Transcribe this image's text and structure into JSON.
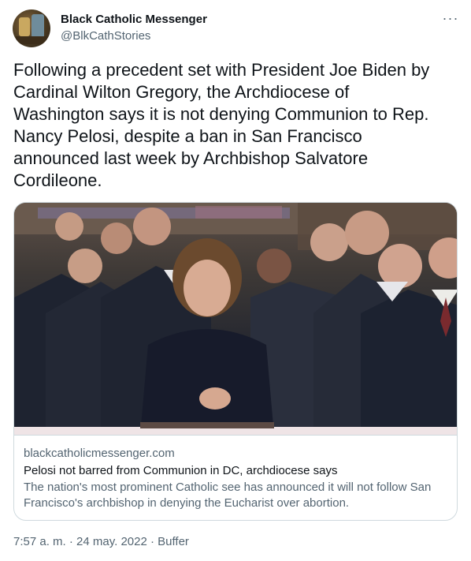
{
  "author": {
    "name": "Black Catholic Messenger",
    "handle": "@BlkCathStories",
    "avatar_icon": "avatar-image"
  },
  "more_icon": "ellipsis-icon",
  "tweet": {
    "text": "Following a precedent set with President Joe Biden by\nCardinal Wilton Gregory, the Archdiocese of\nWashington says it is not denying Communion to Rep.\nNancy Pelosi, despite a ban in San Francisco\nannounced last week by Archbishop Salvatore\nCordileone."
  },
  "link_card": {
    "domain": "blackcatholicmessenger.com",
    "title": "Pelosi not barred from Communion in DC, archdiocese says",
    "description": "The nation's most prominent Catholic see has announced it will not follow San Francisco's archbishop in denying the Eucharist over abortion."
  },
  "meta": {
    "time": "7:57 a. m.",
    "separator1": " · ",
    "date": "24 may. 2022",
    "separator2": " · ",
    "source": "Buffer"
  },
  "colors": {
    "text_primary": "#0f1419",
    "text_secondary": "#536471",
    "border": "#cfd9de"
  }
}
